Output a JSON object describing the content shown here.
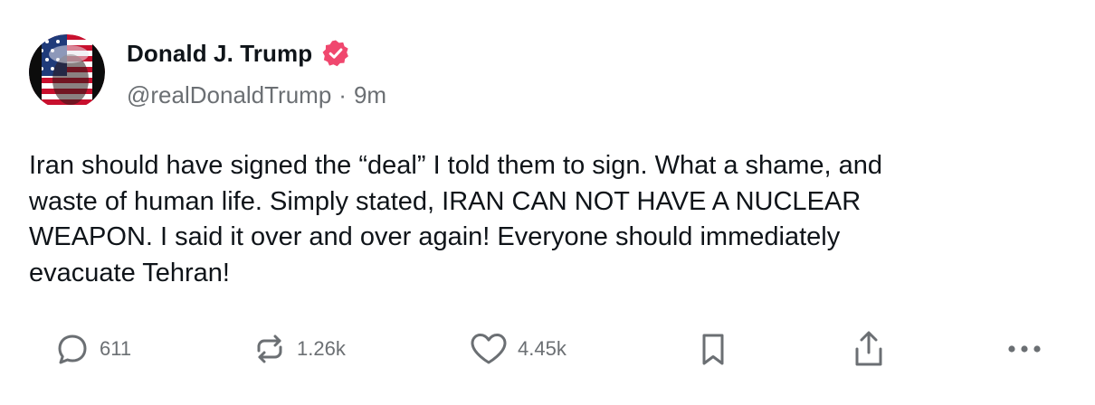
{
  "author": {
    "display_name": "Donald J. Trump",
    "handle": "@realDonaldTrump",
    "separator": "·",
    "time": "9m",
    "verified": true
  },
  "post": {
    "text": "Iran should have signed the “deal” I told them to sign. What a shame, and\nwaste of human life. Simply stated, IRAN CAN NOT HAVE A NUCLEAR\nWEAPON. I said it over and over again! Everyone should immediately\nevacuate Tehran!"
  },
  "actions": {
    "reply": {
      "icon": "reply-icon",
      "count": "611"
    },
    "repost": {
      "icon": "repost-icon",
      "count": "1.26k"
    },
    "like": {
      "icon": "heart-icon",
      "count": "4.45k"
    },
    "bookmark": {
      "icon": "bookmark-icon"
    },
    "share": {
      "icon": "share-icon"
    },
    "more": {
      "icon": "more-icon"
    }
  },
  "colors": {
    "verified_badge": "#f0476e",
    "muted_text": "#6b6f73",
    "main_text": "#0f1419"
  }
}
